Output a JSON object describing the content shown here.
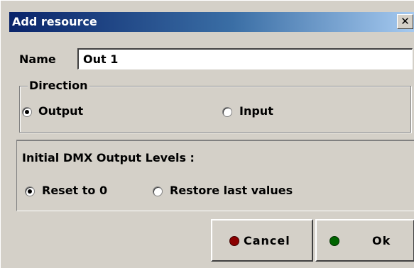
{
  "window": {
    "title": "Add resource",
    "close_glyph": "✕"
  },
  "name_field": {
    "label": "Name",
    "value": "Out 1"
  },
  "direction": {
    "legend": "Direction",
    "options": [
      {
        "label": "Output",
        "selected": true
      },
      {
        "label": "Input",
        "selected": false
      }
    ]
  },
  "levels": {
    "heading": "Initial DMX Output Levels :",
    "options": [
      {
        "label": "Reset to 0",
        "selected": true
      },
      {
        "label": "Restore last values",
        "selected": false
      }
    ]
  },
  "buttons": {
    "cancel_label": "Cancel",
    "cancel_led_color": "#8b0000",
    "ok_label": "Ok",
    "ok_led_color": "#006400"
  }
}
